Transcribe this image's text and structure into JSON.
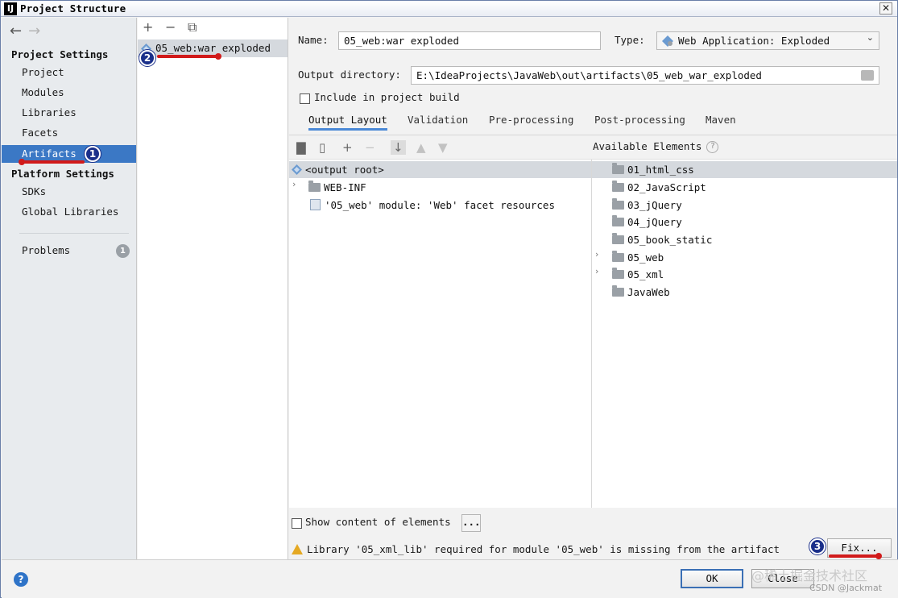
{
  "window": {
    "title": "Project Structure",
    "app_icon": "IJ",
    "close_symbol": "✕"
  },
  "nav": {
    "back": "←",
    "forward": "→"
  },
  "sidebar": {
    "project_settings_title": "Project Settings",
    "project_items": [
      "Project",
      "Modules",
      "Libraries",
      "Facets",
      "Artifacts"
    ],
    "platform_settings_title": "Platform Settings",
    "platform_items": [
      "SDKs",
      "Global Libraries"
    ],
    "problems_label": "Problems",
    "problems_count": "1",
    "selected": "Artifacts"
  },
  "artifacts": {
    "toolbar": {
      "add": "+",
      "remove": "−",
      "copy": "⧉"
    },
    "items": [
      "05_web:war exploded"
    ]
  },
  "form": {
    "name_label": "Name:",
    "name_value": "05_web:war exploded",
    "type_label": "Type:",
    "type_value": "Web Application: Exploded",
    "output_label": "Output directory:",
    "output_value": "E:\\IdeaProjects\\JavaWeb\\out\\artifacts\\05_web_war_exploded",
    "include_label": "Include in project build",
    "include_checked": false
  },
  "tabs": [
    "Output Layout",
    "Validation",
    "Pre-processing",
    "Post-processing",
    "Maven"
  ],
  "active_tab": "Output Layout",
  "layout": {
    "available_label": "Available Elements",
    "help_symbol": "?",
    "tree": [
      {
        "label": "<output root>",
        "icon": "artifact-gem-icon",
        "selected": true,
        "expandable": false
      },
      {
        "label": "WEB-INF",
        "icon": "folder-icon",
        "selected": false,
        "expandable": true
      },
      {
        "label": "'05_web' module: 'Web' facet resources",
        "icon": "facet-resources-icon",
        "selected": false,
        "expandable": false
      }
    ],
    "available": [
      {
        "label": "01_html_css",
        "expandable": false,
        "selected": true
      },
      {
        "label": "02_JavaScript",
        "expandable": false,
        "selected": false
      },
      {
        "label": "03_jQuery",
        "expandable": false,
        "selected": false
      },
      {
        "label": "04_jQuery",
        "expandable": false,
        "selected": false
      },
      {
        "label": "05_book_static",
        "expandable": false,
        "selected": false
      },
      {
        "label": "05_web",
        "expandable": true,
        "selected": false
      },
      {
        "label": "05_xml",
        "expandable": true,
        "selected": false
      },
      {
        "label": "JavaWeb",
        "expandable": false,
        "selected": false
      }
    ]
  },
  "options": {
    "show_content_label": "Show content of elements",
    "show_content_checked": false,
    "dots_label": "...",
    "warning_text": "Library '05_xml_lib' required for module '05_web' is missing from the artifact",
    "fix_label": "Fix..."
  },
  "footer": {
    "help_symbol": "?",
    "ok_label": "OK",
    "close_label": "Close"
  },
  "annotations": {
    "marker1": "1",
    "marker2": "2",
    "marker3": "3"
  },
  "watermarks": {
    "cn": "@稀土掘金技术社区",
    "csdn": "CSDN @Jackmat"
  },
  "colors": {
    "selection": "#3b78c5",
    "tab_underline": "#4a88d6",
    "annotation_red": "#d11a1a",
    "marker_blue": "#1a2f8a",
    "warning": "#e5a923"
  }
}
